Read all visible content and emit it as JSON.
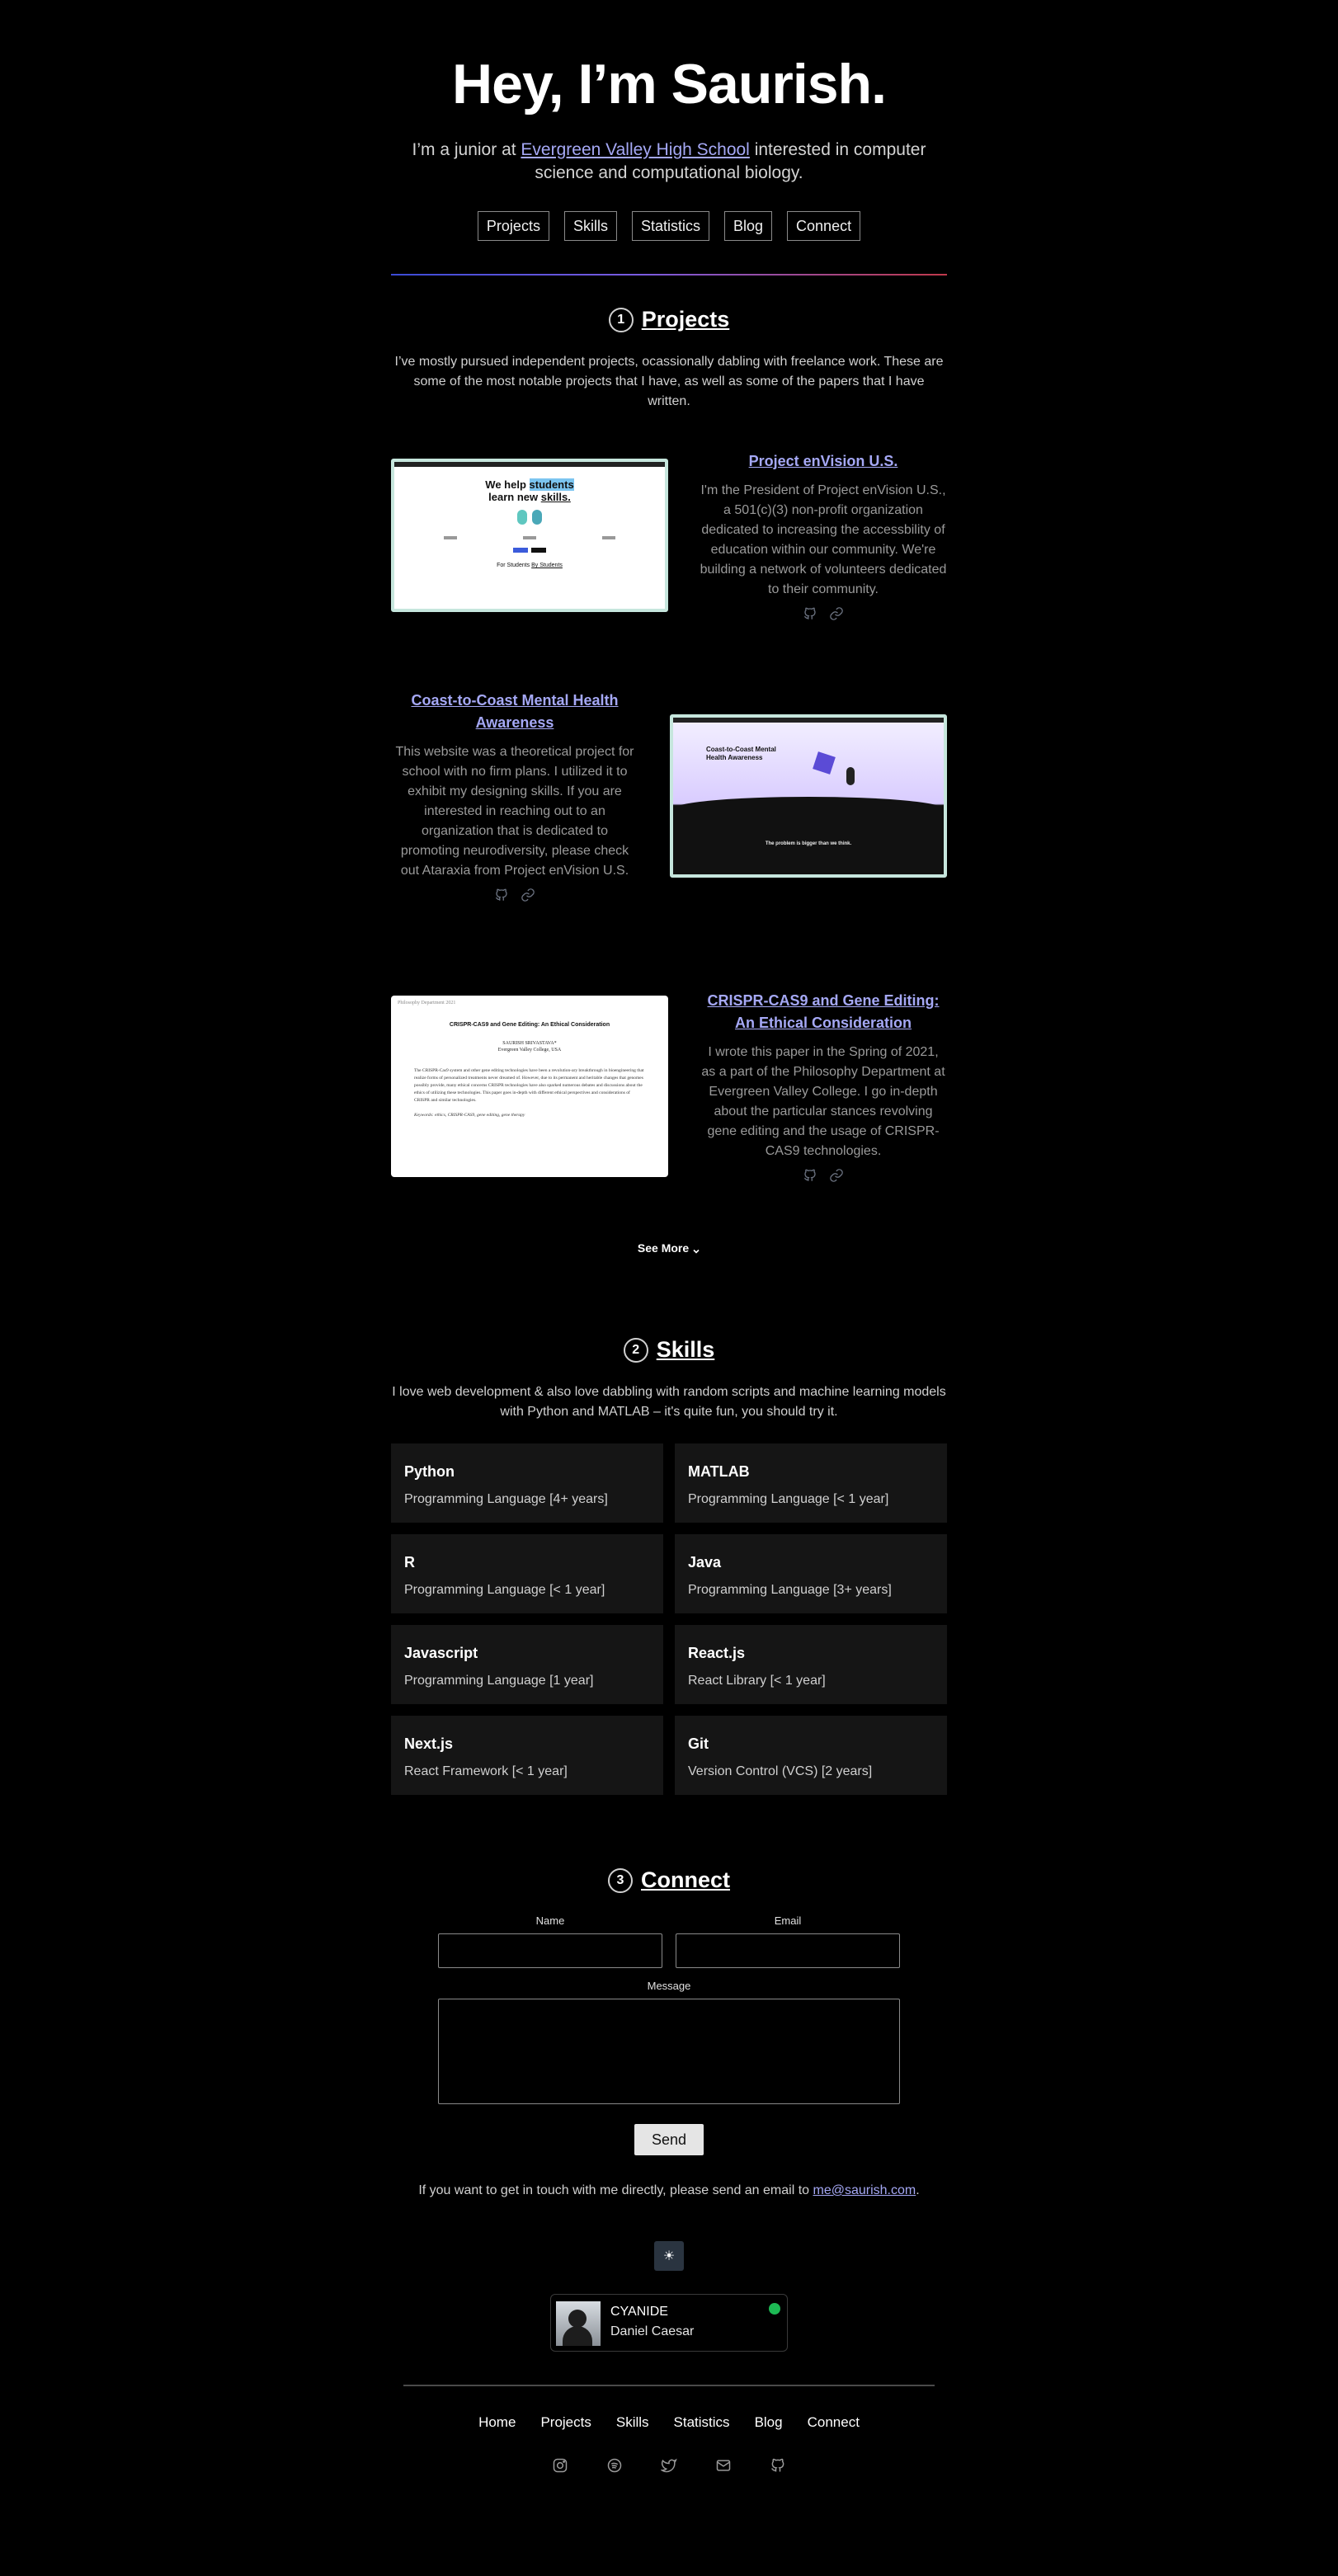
{
  "header": {
    "title": "Hey, I’m Saurish.",
    "intro_before": "I’m a junior at ",
    "intro_link": "Evergreen Valley High School",
    "intro_after": " interested in computer science and computational biology."
  },
  "nav": [
    "Projects",
    "Skills",
    "Statistics",
    "Blog",
    "Connect"
  ],
  "projects_section": {
    "number": "1",
    "title": "Projects",
    "description": "I’ve mostly pursued independent projects, ocassionally dabling with freelance work. These are some of the most notable projects that I have, as well as some of the papers that I have written.",
    "items": [
      {
        "title": "Project enVision U.S.",
        "description": "I'm the President of Project enVision U.S., a 501(c)(3) non-profit organization dedicated to increasing the accessbility of education within our community. We're building a network of volunteers dedicated to their community.",
        "shot_headline_a": "We help ",
        "shot_headline_hl": "students",
        "shot_headline_b": "learn new ",
        "shot_headline_hl2": "skills.",
        "shot_footer_a": "For Students ",
        "shot_footer_b": "By Students"
      },
      {
        "title": "Coast-to-Coast Mental Health Awareness",
        "description": "This website was a theoretical project for school with no firm plans. I utilized it to exhibit my designing skills. If you are interested in reaching out to an organization that is dedicated to promoting neurodiversity, please check out Ataraxia from Project enVision U.S.",
        "shot_headline": "Coast-to-Coast Mental Health Awareness",
        "shot_banner": "The problem is bigger than we think."
      },
      {
        "title": "CRISPR-CAS9 and Gene Editing: An Ethical Consideration",
        "description": "I wrote this paper in the Spring of 2021, as a part of the Philosophy Department at Evergreen Valley College. I go in-depth about the particular stances revolving gene editing and the usage of CRISPR-CAS9 technologies.",
        "paper_header": "Philosophy Department 2021",
        "paper_title": "CRISPR-CAS9 and Gene Editing: An Ethical Consideration",
        "paper_author": "SAURISH SRIVASTAVA*",
        "paper_affil": "Evergreen Valley College, USA",
        "paper_abstract": "The CRISPR-Cas9 system and other gene editing technologies have been a revolution-ary breakthrough in bioengineering that realize forms of personalized treatments never dreamed of. However, due to its permanent and heritable changes that genomes possibly provide, many ethical concerns CRISPR technologies have also sparked numerous debates and discussions about the ethics of utilizing these technologies. This paper goes in-depth with different ethical perspectives and considerations of CRISPR and similar technologies.",
        "paper_keywords": "Keywords: ethics, CRISPR-CAS9, gene editing, gene therapy"
      }
    ],
    "see_more": "See More"
  },
  "skills_section": {
    "number": "2",
    "title": "Skills",
    "description": "I love web development & also love dabbling with random scripts and machine learning models with Python and MATLAB – it's quite fun, you should try it.",
    "items": [
      {
        "name": "Python",
        "detail": "Programming Language [4+ years]"
      },
      {
        "name": "MATLAB",
        "detail": "Programming Language [< 1 year]"
      },
      {
        "name": "R",
        "detail": "Programming Language [< 1 year]"
      },
      {
        "name": "Java",
        "detail": "Programming Language [3+ years]"
      },
      {
        "name": "Javascript",
        "detail": "Programming Language [1 year]"
      },
      {
        "name": "React.js",
        "detail": "React Library [< 1 year]"
      },
      {
        "name": "Next.js",
        "detail": "React Framework [< 1 year]"
      },
      {
        "name": "Git",
        "detail": "Version Control (VCS) [2 years]"
      }
    ]
  },
  "connect_section": {
    "number": "3",
    "title": "Connect",
    "name_label": "Name",
    "email_label": "Email",
    "message_label": "Message",
    "send_label": "Send",
    "note_before": "If you want to get in touch with me directly, please send an email to ",
    "note_email": "me@saurish.com",
    "note_after": "."
  },
  "theme_toggle": "☀",
  "now_playing": {
    "track": "CYANIDE",
    "artist": "Daniel Caesar"
  },
  "footer": {
    "nav": [
      "Home",
      "Projects",
      "Skills",
      "Statistics",
      "Blog",
      "Connect"
    ],
    "social_icons": [
      "instagram-icon",
      "spotify-icon",
      "twitter-icon",
      "mail-icon",
      "github-icon"
    ]
  },
  "colors": {
    "background": "#000000",
    "link": "#a5a8f5",
    "card": "#151515",
    "thumb_border": "#c6e6dd",
    "spotify": "#1db954"
  }
}
